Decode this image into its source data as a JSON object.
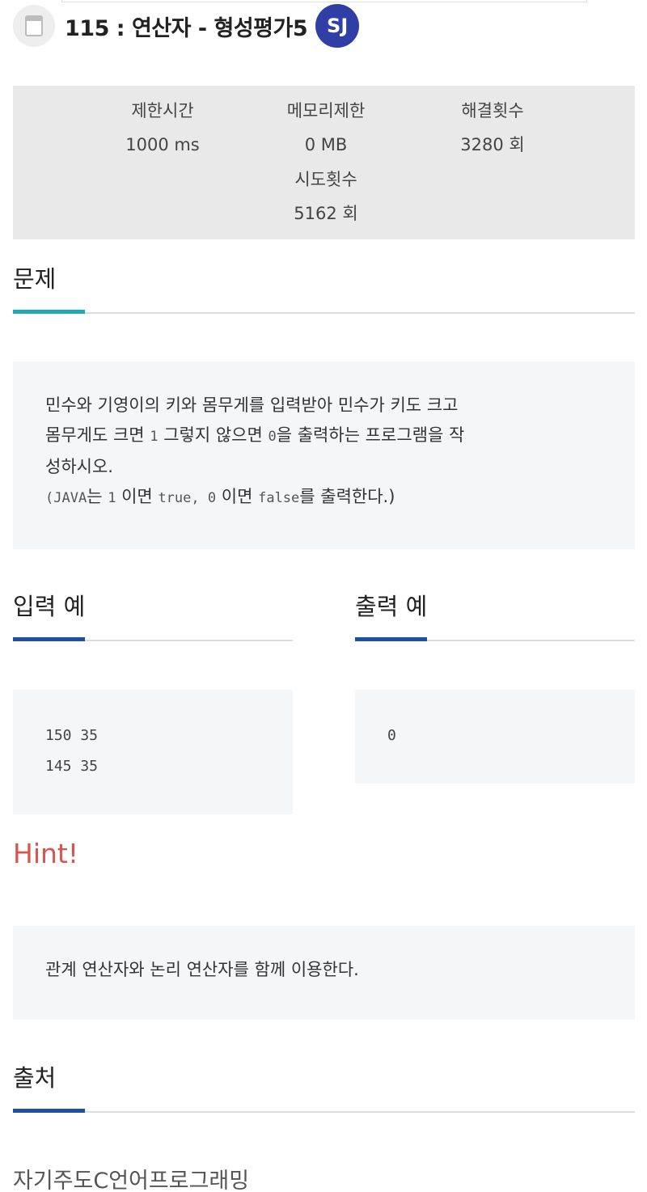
{
  "header": {
    "title": "115 : 연산자 - 형성평가5",
    "avatar_initials": "SJ"
  },
  "stats": {
    "time_limit": {
      "label": "제한시간",
      "value": "1000 ms"
    },
    "memory_limit": {
      "label": "메모리제한",
      "value": "0 MB"
    },
    "solved_count": {
      "label": "해결횟수",
      "value": "3280 회"
    },
    "attempt_count": {
      "label": "시도횟수",
      "value": "5162 회"
    }
  },
  "problem": {
    "title": "문제",
    "line1": "민수와 기영이의 키와 몸무게를 입력받아 민수가 키도 크고",
    "line2_a": "몸무게도 크면 ",
    "line2_b": "1",
    "line2_c": " 그렇지 않으면 ",
    "line2_d": "0",
    "line2_e": "을 출력하는 프로그램을 작",
    "line3": "성하시오.",
    "line4_a": "(JAVA",
    "line4_b": "는 ",
    "line4_c": "1",
    "line4_d": " 이면 ",
    "line4_e": "true, 0",
    "line4_f": " 이면 ",
    "line4_g": "false",
    "line4_h": "를 출력한다.)"
  },
  "sample_input": {
    "title": "입력 예",
    "line1": "150 35",
    "line2": "145 35"
  },
  "sample_output": {
    "title": "출력 예",
    "line1": "0"
  },
  "hint": {
    "title": "Hint!",
    "text": "관계 연산자와 논리 연산자를 함께 이용한다."
  },
  "source": {
    "title": "출처",
    "text": "자기주도C언어프로그래밍"
  },
  "colors": {
    "problem_accent": "#1fa9b4",
    "section_accent": "#1f4fa3",
    "hint": "#d9534f",
    "avatar": "#2f3fa6"
  }
}
